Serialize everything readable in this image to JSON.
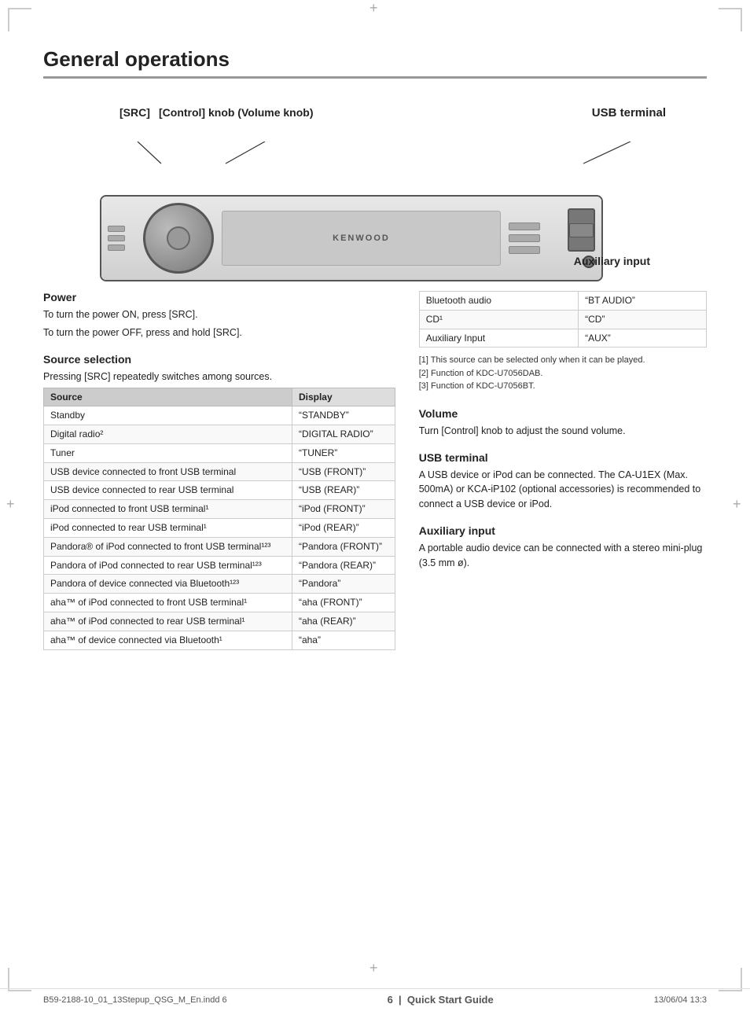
{
  "page": {
    "title": "General operations",
    "footer_left": "B59-2188-10_01_13Stepup_QSG_M_En.indd   6",
    "footer_right": "13/06/04   13:3",
    "page_number": "6",
    "page_label": "Quick Start Guide"
  },
  "diagram": {
    "label_src": "[SRC]",
    "label_control": "[Control] knob (Volume knob)",
    "label_usb": "USB terminal",
    "label_aux": "Auxiliary input",
    "device_brand": "KENWOOD"
  },
  "power_section": {
    "heading": "Power",
    "text1": "To turn the power ON, press [SRC].",
    "text2": "To turn the power OFF, press and hold [SRC]."
  },
  "source_selection": {
    "heading": "Source selection",
    "text": "Pressing [SRC] repeatedly switches among sources.",
    "table_headers": [
      "Source",
      "Display"
    ],
    "table_rows": [
      [
        "Standby",
        "“STANDBY”"
      ],
      [
        "Digital radio²",
        "“DIGITAL RADIO”"
      ],
      [
        "Tuner",
        "“TUNER”"
      ],
      [
        "USB device connected to front USB terminal",
        "“USB (FRONT)”"
      ],
      [
        "USB device connected to rear USB terminal",
        "“USB (REAR)”"
      ],
      [
        "iPod connected to front USB terminal¹",
        "“iPod (FRONT)”"
      ],
      [
        "iPod connected to rear USB terminal¹",
        "“iPod (REAR)”"
      ],
      [
        "Pandora® of iPod connected to front USB terminal¹²³",
        "“Pandora (FRONT)”"
      ],
      [
        "Pandora of iPod connected to rear USB terminal¹²³",
        "“Pandora (REAR)”"
      ],
      [
        "Pandora of device connected via Bluetooth¹²³",
        "“Pandora”"
      ],
      [
        "aha™ of iPod connected to front USB terminal¹",
        "“aha (FRONT)”"
      ],
      [
        "aha™ of iPod connected to rear USB terminal¹",
        "“aha (REAR)”"
      ],
      [
        "aha™ of device connected via Bluetooth¹",
        "“aha”"
      ]
    ]
  },
  "right_table": {
    "rows": [
      [
        "Bluetooth audio",
        "“BT AUDIO”"
      ],
      [
        "CD¹",
        "“CD”"
      ],
      [
        "Auxiliary Input",
        "“AUX”"
      ]
    ],
    "footnotes": [
      "[1] This source can be selected only when it can be played.",
      "[2] Function of KDC-U7056DAB.",
      "[3] Function of KDC-U7056BT."
    ]
  },
  "volume_section": {
    "heading": "Volume",
    "text": "Turn [Control] knob to adjust the sound volume."
  },
  "usb_section": {
    "heading": "USB terminal",
    "text": "A USB device or iPod can be connected. The CA-U1EX (Max. 500mA) or KCA-iP102 (optional accessories) is recommended to connect a USB device or iPod."
  },
  "aux_section": {
    "heading": "Auxiliary input",
    "text": "A portable audio device can be connected with a stereo mini-plug (3.5 mm ø)."
  }
}
